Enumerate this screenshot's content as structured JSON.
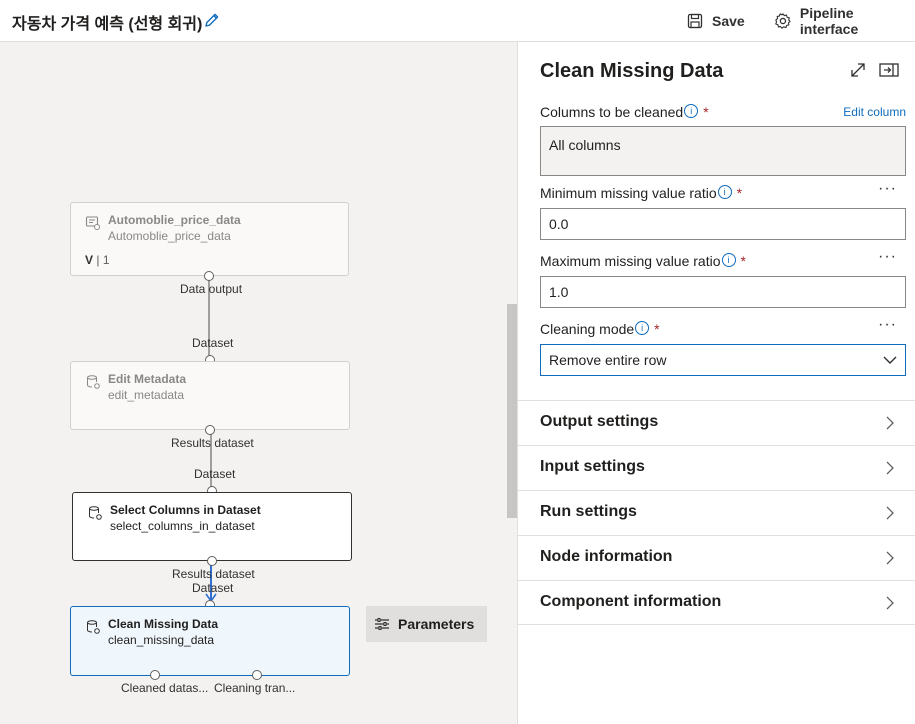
{
  "header": {
    "title": "자동차 가격 예측 (선형 회귀)",
    "save_label": "Save",
    "pipeline_interface_label": "Pipeline interface"
  },
  "canvas": {
    "nodes": [
      {
        "title": "Automoblie_price_data",
        "subtitle": "Automoblie_price_data",
        "version_label": "V",
        "version_value": "1"
      },
      {
        "title": "Edit Metadata",
        "subtitle": "edit_metadata"
      },
      {
        "title": "Select Columns in Dataset",
        "subtitle": "select_columns_in_dataset"
      },
      {
        "title": "Clean Missing Data",
        "subtitle": "clean_missing_data"
      }
    ],
    "port_labels": {
      "data_output": "Data output",
      "dataset_1": "Dataset",
      "results_dataset_1": "Results dataset",
      "dataset_2": "Dataset",
      "results_dataset_2": "Results dataset",
      "dataset_3": "Dataset",
      "cleaned_dataset": "Cleaned datas...",
      "cleaning_transformation": "Cleaning tran..."
    },
    "parameters_button": "Parameters"
  },
  "panel": {
    "title": "Clean Missing Data",
    "columns_label": "Columns to be cleaned",
    "edit_column": "Edit column",
    "columns_value": "All columns",
    "min_ratio_label": "Minimum missing value ratio",
    "min_ratio_value": "0.0",
    "max_ratio_label": "Maximum missing value ratio",
    "max_ratio_value": "1.0",
    "cleaning_mode_label": "Cleaning mode",
    "cleaning_mode_value": "Remove entire row",
    "required_mark": "*",
    "info_glyph": "i",
    "more_glyph": "···",
    "sections": [
      "Output settings",
      "Input settings",
      "Run settings",
      "Node information",
      "Component information"
    ]
  },
  "colors": {
    "accent": "#0f6cbd",
    "canvas_bg": "#f3f2f1",
    "edge_active": "#2f6fd0"
  }
}
